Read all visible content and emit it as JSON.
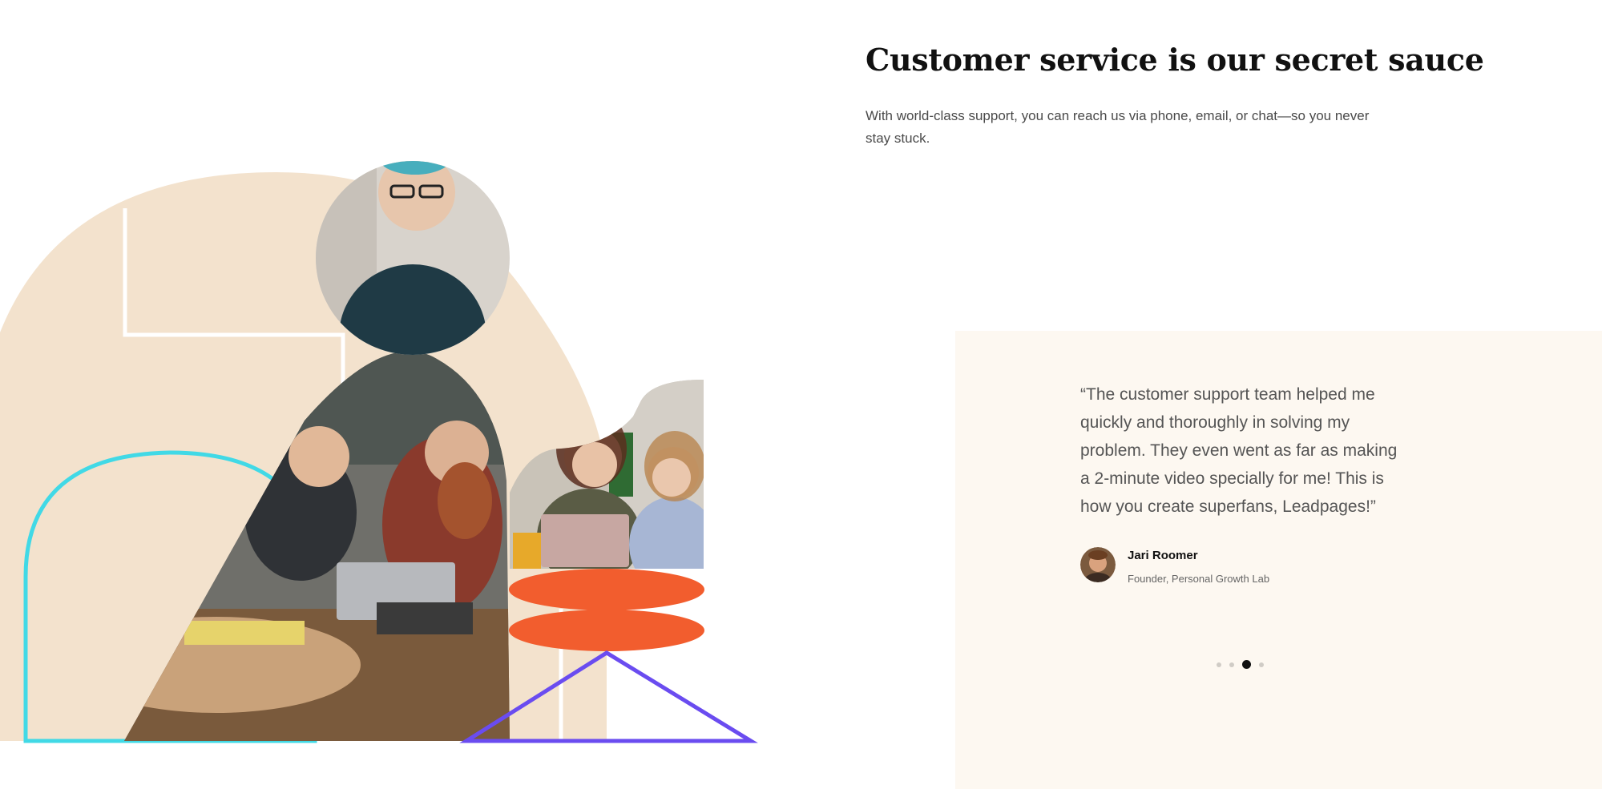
{
  "section": {
    "heading": "Customer service is our secret sauce",
    "subtext": "With world-class support, you can reach us via phone, email, or chat—so you never stay stuck."
  },
  "testimonial": {
    "quote": "“The customer support team helped me quickly and thoroughly in solving my problem. They even went as far as making a 2-minute video specially for me! This is how you create superfans, Leadpages!”",
    "author_name": "Jari Roomer",
    "author_title": "Founder, Personal Growth Lab",
    "slides_total": 4,
    "active_slide": 3
  },
  "colors": {
    "beige_shape": "#f3e2cd",
    "panel_background": "#fdf8f1",
    "cyan_outline": "#41d9e6",
    "purple_outline": "#6a4cf0",
    "orange_ellipses": "#f25d2e",
    "heading_text": "#111111"
  },
  "icons": {
    "carousel_dot": "dot",
    "author_avatar": "avatar"
  }
}
